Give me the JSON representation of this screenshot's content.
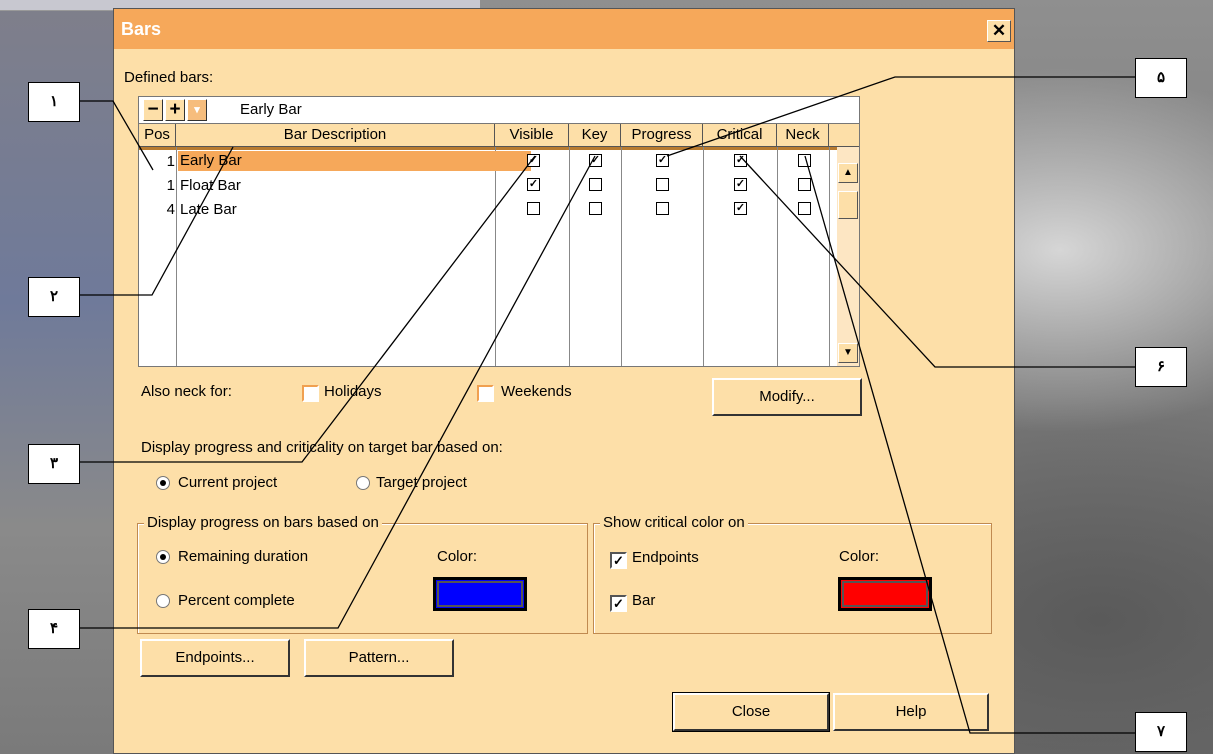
{
  "dialog": {
    "title": "Bars",
    "close_glyph": "✕",
    "defined_bars_label": "Defined bars:",
    "edit": {
      "minus": "−",
      "plus": "+",
      "dropdown": "▾",
      "value": "Early Bar"
    },
    "grid": {
      "headers": [
        "Pos",
        "Bar Description",
        "Visible",
        "Key",
        "Progress",
        "Critical",
        "Neck"
      ],
      "rows": [
        {
          "pos": "1",
          "desc": "Early Bar",
          "visible": true,
          "key": true,
          "progress": true,
          "critical": true,
          "neck": false,
          "selected": true
        },
        {
          "pos": "1",
          "desc": "Float Bar",
          "visible": true,
          "key": false,
          "progress": false,
          "critical": true,
          "neck": false,
          "selected": false
        },
        {
          "pos": "4",
          "desc": "Late Bar",
          "visible": false,
          "key": false,
          "progress": false,
          "critical": true,
          "neck": false,
          "selected": false
        }
      ],
      "scroll_up": "▲",
      "scroll_down": "▼"
    },
    "neck": {
      "label": "Also neck for:",
      "holidays": "Holidays",
      "weekends": "Weekends",
      "modify": "Modify..."
    },
    "target": {
      "label": "Display progress and criticality on target bar based on:",
      "current": "Current project",
      "target": "Target project"
    },
    "progress_group": {
      "title": "Display progress on bars based on",
      "remaining": "Remaining duration",
      "percent": "Percent complete",
      "color_label": "Color:",
      "color": "#0000ff"
    },
    "critical_group": {
      "title": "Show critical color on",
      "endpoints": "Endpoints",
      "bar": "Bar",
      "color_label": "Color:",
      "color": "#ff0000"
    },
    "buttons": {
      "endpoints": "Endpoints...",
      "pattern": "Pattern...",
      "close": "Close",
      "help": "Help"
    }
  },
  "callouts": [
    "١",
    "٢",
    "٣",
    "۴",
    "۵",
    "۶",
    "٧"
  ],
  "check_glyph": "✓"
}
